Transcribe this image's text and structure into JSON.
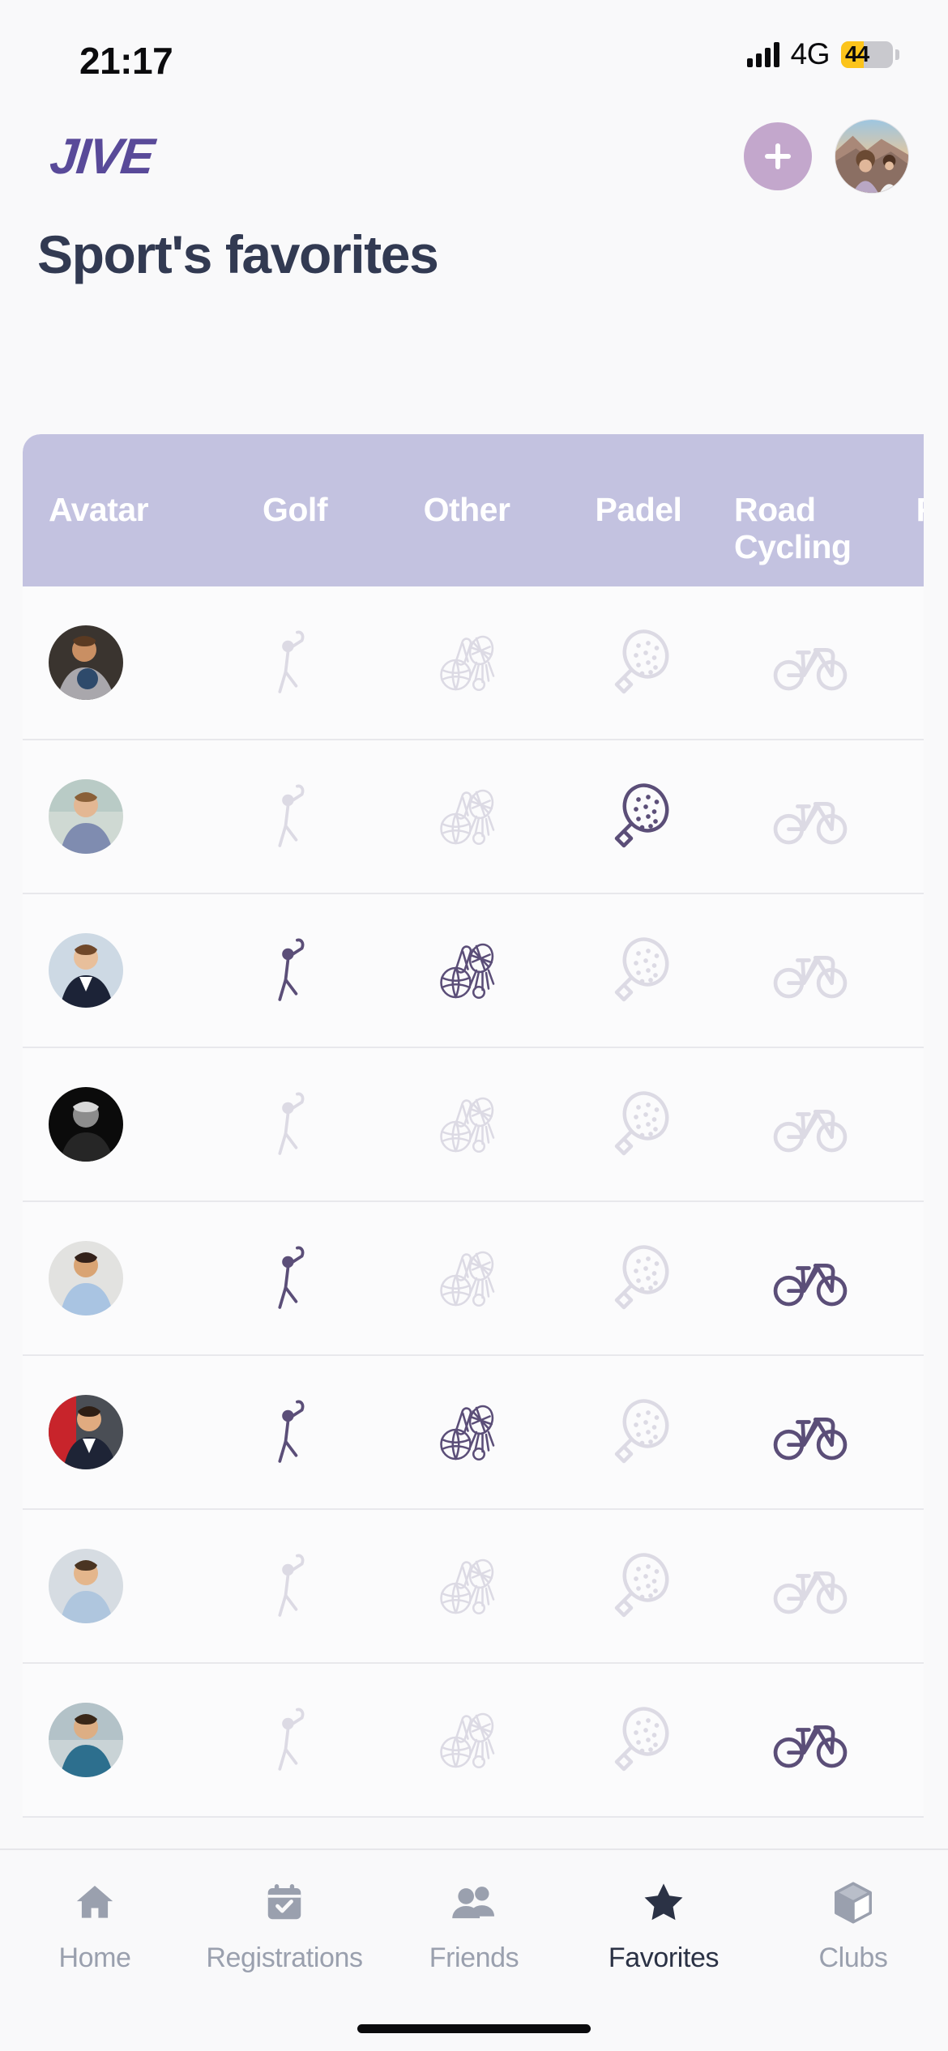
{
  "status_bar": {
    "time": "21:17",
    "network": "4G",
    "battery_percent": "44",
    "battery_level": 44,
    "signal_icon": "signal-bars-icon",
    "battery_low_power_color": "#FCC41B"
  },
  "header": {
    "logo_text": "JIVE",
    "logo_color": "#594A99",
    "add_button_label": "+",
    "add_button_icon": "plus-icon",
    "add_button_color": "#C3A7CC",
    "avatar_icon": "user-avatar"
  },
  "page": {
    "title": "Sport's favorites",
    "title_color": "#323A52"
  },
  "table": {
    "header_bg": "#C3C2E0",
    "header_text_color": "#FFFFFF",
    "active_icon_color": "#5B4E78",
    "inactive_icon_color": "#DCDAE4",
    "columns": [
      {
        "key": "avatar",
        "label": "Avatar",
        "icon": ""
      },
      {
        "key": "golf",
        "label": "Golf",
        "icon": "golf-swing-icon"
      },
      {
        "key": "other",
        "label": "Other",
        "icon": "multi-sport-icon"
      },
      {
        "key": "padel",
        "label": "Padel",
        "icon": "padel-racket-icon"
      },
      {
        "key": "road_cycling",
        "label": "Road Cycling",
        "icon": "road-bike-icon"
      },
      {
        "key": "running",
        "label": "Running",
        "icon": "running-shoe-icon"
      }
    ],
    "rows": [
      {
        "avatar": "avatar-man-with-child",
        "golf": false,
        "other": false,
        "padel": false,
        "road_cycling": false,
        "running": false
      },
      {
        "avatar": "avatar-man-blue-shirt-arms-crossed",
        "golf": false,
        "other": false,
        "padel": true,
        "road_cycling": false,
        "running": false
      },
      {
        "avatar": "avatar-man-navy-suit",
        "golf": true,
        "other": true,
        "padel": false,
        "road_cycling": false,
        "running": false
      },
      {
        "avatar": "avatar-black-and-white-portrait",
        "golf": false,
        "other": false,
        "padel": false,
        "road_cycling": false,
        "running": false
      },
      {
        "avatar": "avatar-man-light-blue-shirt",
        "golf": true,
        "other": false,
        "padel": false,
        "road_cycling": true,
        "running": true
      },
      {
        "avatar": "avatar-man-dark-blazer-red-background",
        "golf": true,
        "other": true,
        "padel": false,
        "road_cycling": true,
        "running": false
      },
      {
        "avatar": "avatar-man-smiling-blue-shirt",
        "golf": false,
        "other": false,
        "padel": false,
        "road_cycling": false,
        "running": false
      },
      {
        "avatar": "avatar-man-teal-sweater",
        "golf": false,
        "other": false,
        "padel": false,
        "road_cycling": true,
        "running": false
      }
    ]
  },
  "bottom_nav": {
    "items": [
      {
        "label": "Home",
        "icon": "home-icon",
        "active": false
      },
      {
        "label": "Registrations",
        "icon": "calendar-check-icon",
        "active": false
      },
      {
        "label": "Friends",
        "icon": "people-icon",
        "active": false
      },
      {
        "label": "Favorites",
        "icon": "star-icon",
        "active": true
      },
      {
        "label": "Clubs",
        "icon": "cube-icon",
        "active": false
      }
    ],
    "active_color": "#2B3245",
    "inactive_color": "#9AA0AE"
  }
}
